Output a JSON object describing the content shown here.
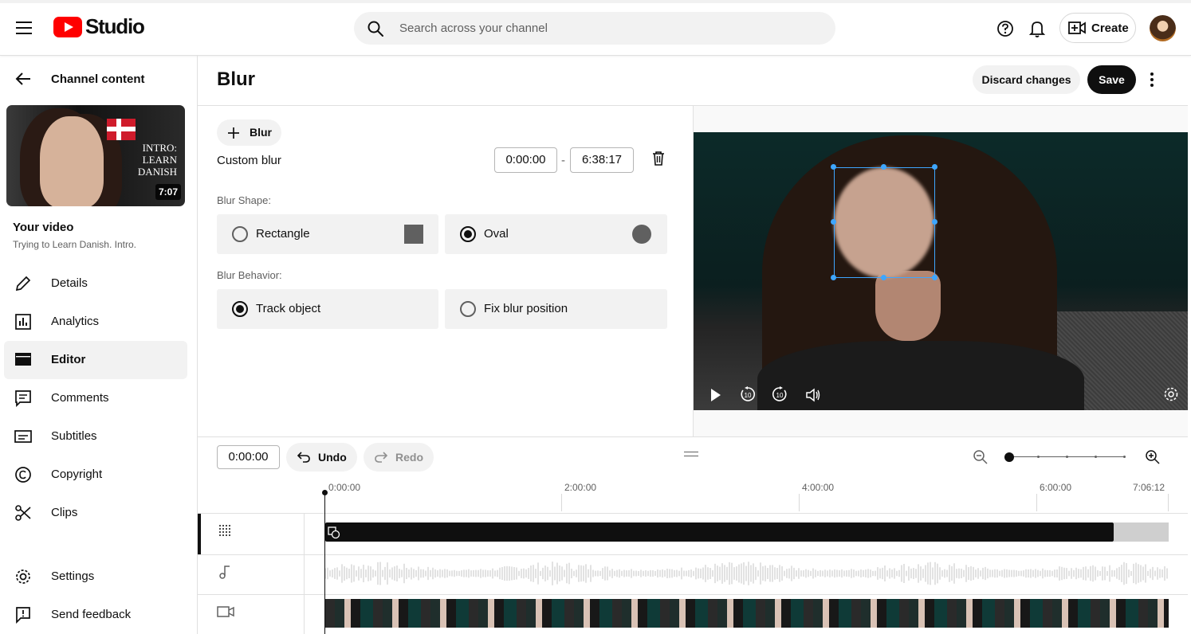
{
  "app": {
    "logo_text": "Studio",
    "search_placeholder": "Search across your channel",
    "create_label": "Create"
  },
  "sidebar": {
    "back_label": "Channel content",
    "video": {
      "thumbnail_title": [
        "INTRO:",
        "LEARN",
        "DANISH"
      ],
      "duration": "7:07",
      "heading": "Your video",
      "title": "Trying to Learn Danish. Intro."
    },
    "items": [
      {
        "label": "Details",
        "icon": "pencil-icon",
        "active": false
      },
      {
        "label": "Analytics",
        "icon": "analytics-icon",
        "active": false
      },
      {
        "label": "Editor",
        "icon": "clapperboard-icon",
        "active": true
      },
      {
        "label": "Comments",
        "icon": "comment-icon",
        "active": false
      },
      {
        "label": "Subtitles",
        "icon": "subtitles-icon",
        "active": false
      },
      {
        "label": "Copyright",
        "icon": "copyright-icon",
        "active": false
      },
      {
        "label": "Clips",
        "icon": "scissors-icon",
        "active": false
      }
    ],
    "settings_label": "Settings",
    "feedback_label": "Send feedback"
  },
  "editor": {
    "title": "Blur",
    "discard_label": "Discard changes",
    "save_label": "Save",
    "add_blur_label": "Blur",
    "blur_name": "Custom blur",
    "start_time": "0:00:00",
    "time_separator": "-",
    "end_time": "6:38:17",
    "shape_label": "Blur Shape:",
    "shape_options": [
      {
        "label": "Rectangle",
        "selected": false
      },
      {
        "label": "Oval",
        "selected": true
      }
    ],
    "behavior_label": "Blur Behavior:",
    "behavior_options": [
      {
        "label": "Track object",
        "selected": true
      },
      {
        "label": "Fix blur position",
        "selected": false
      }
    ]
  },
  "timeline": {
    "current_time": "0:00:00",
    "undo_label": "Undo",
    "redo_label": "Redo",
    "ruler_labels": [
      "0:00:00",
      "2:00:00",
      "4:00:00",
      "6:00:00",
      "7:06:12"
    ],
    "zoom_level": 0
  },
  "colors": {
    "accent_blue": "#3ea6ff",
    "youtube_red": "#ff0000",
    "text_primary": "#0f0f0f",
    "text_secondary": "#606060"
  }
}
